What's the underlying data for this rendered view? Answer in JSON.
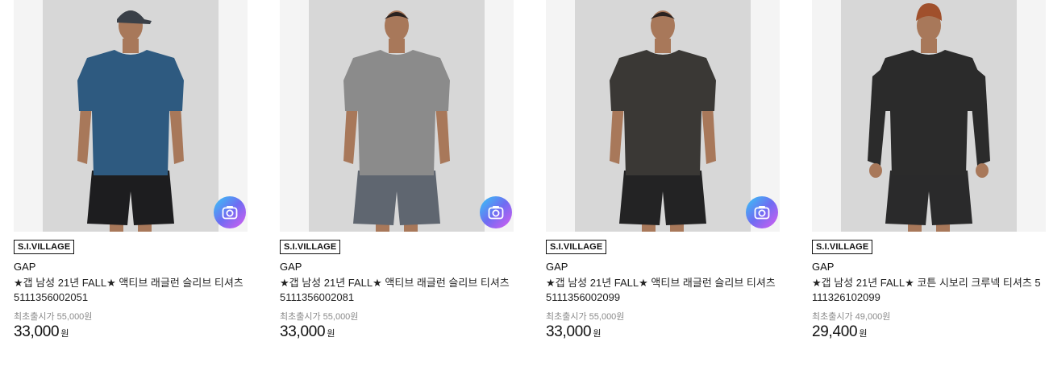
{
  "products": [
    {
      "seller_badge": "S.I.VILLAGE",
      "brand": "GAP",
      "title": "★갭 남성 21년 FALL★ 액티브 래글런 슬리브 티셔츠 5111356002051",
      "original_price_label": "최초출시가 55,000원",
      "price": "33,000",
      "currency": "원",
      "shirt_color": "#2e5a80",
      "shorts_color": "#1d1d1f",
      "has_cap": true,
      "has_camera_badge": true
    },
    {
      "seller_badge": "S.I.VILLAGE",
      "brand": "GAP",
      "title": "★갭 남성 21년 FALL★ 액티브 래글런 슬리브 티셔츠 5111356002081",
      "original_price_label": "최초출시가 55,000원",
      "price": "33,000",
      "currency": "원",
      "shirt_color": "#8b8b8b",
      "shorts_color": "#5f6670",
      "has_cap": false,
      "has_camera_badge": true
    },
    {
      "seller_badge": "S.I.VILLAGE",
      "brand": "GAP",
      "title": "★갭 남성 21년 FALL★ 액티브 래글런 슬리브 티셔츠 5111356002099",
      "original_price_label": "최초출시가 55,000원",
      "price": "33,000",
      "currency": "원",
      "shirt_color": "#3a3835",
      "shorts_color": "#232324",
      "has_cap": false,
      "has_camera_badge": true
    },
    {
      "seller_badge": "S.I.VILLAGE",
      "brand": "GAP",
      "title": "★갭 남성 21년 FALL★ 코튼 시보리 크루넥 티셔츠 5111326102099",
      "original_price_label": "최초출시가 49,000원",
      "price": "29,400",
      "currency": "원",
      "shirt_color": "#2b2b2b",
      "shorts_color": "#2a2a2b",
      "has_cap": false,
      "has_camera_badge": false
    }
  ]
}
